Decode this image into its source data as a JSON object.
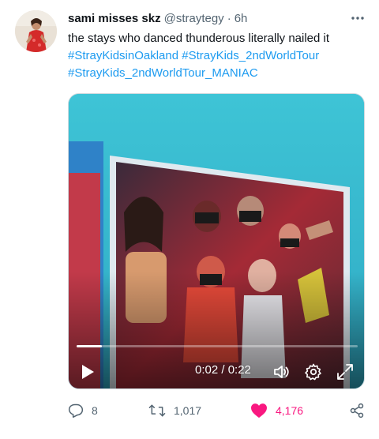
{
  "tweet": {
    "display_name": "sami misses skz",
    "handle": "@straytegy",
    "separator": "·",
    "timestamp": "6h",
    "text": "the stays who danced thunderous literally nailed it",
    "hashtags_line1": "#StrayKidsinOakland #StrayKids_2ndWorldTour",
    "hashtags_line2": "#StrayKids_2ndWorldTour_MANIAC"
  },
  "video": {
    "time_readout": "0:02 / 0:22",
    "progress": 0.09
  },
  "actions": {
    "replies": "8",
    "retweets": "1,017",
    "likes": "4,176"
  },
  "icons": {
    "more": "more-dots-icon",
    "play": "play-icon",
    "volume": "volume-icon",
    "settings": "gear-icon",
    "fullscreen": "expand-icon",
    "reply": "reply-icon",
    "retweet": "retweet-icon",
    "like": "heart-icon",
    "share": "share-icon"
  },
  "colors": {
    "link": "#1d9bf0",
    "like": "#f91880",
    "muted": "#536471"
  }
}
